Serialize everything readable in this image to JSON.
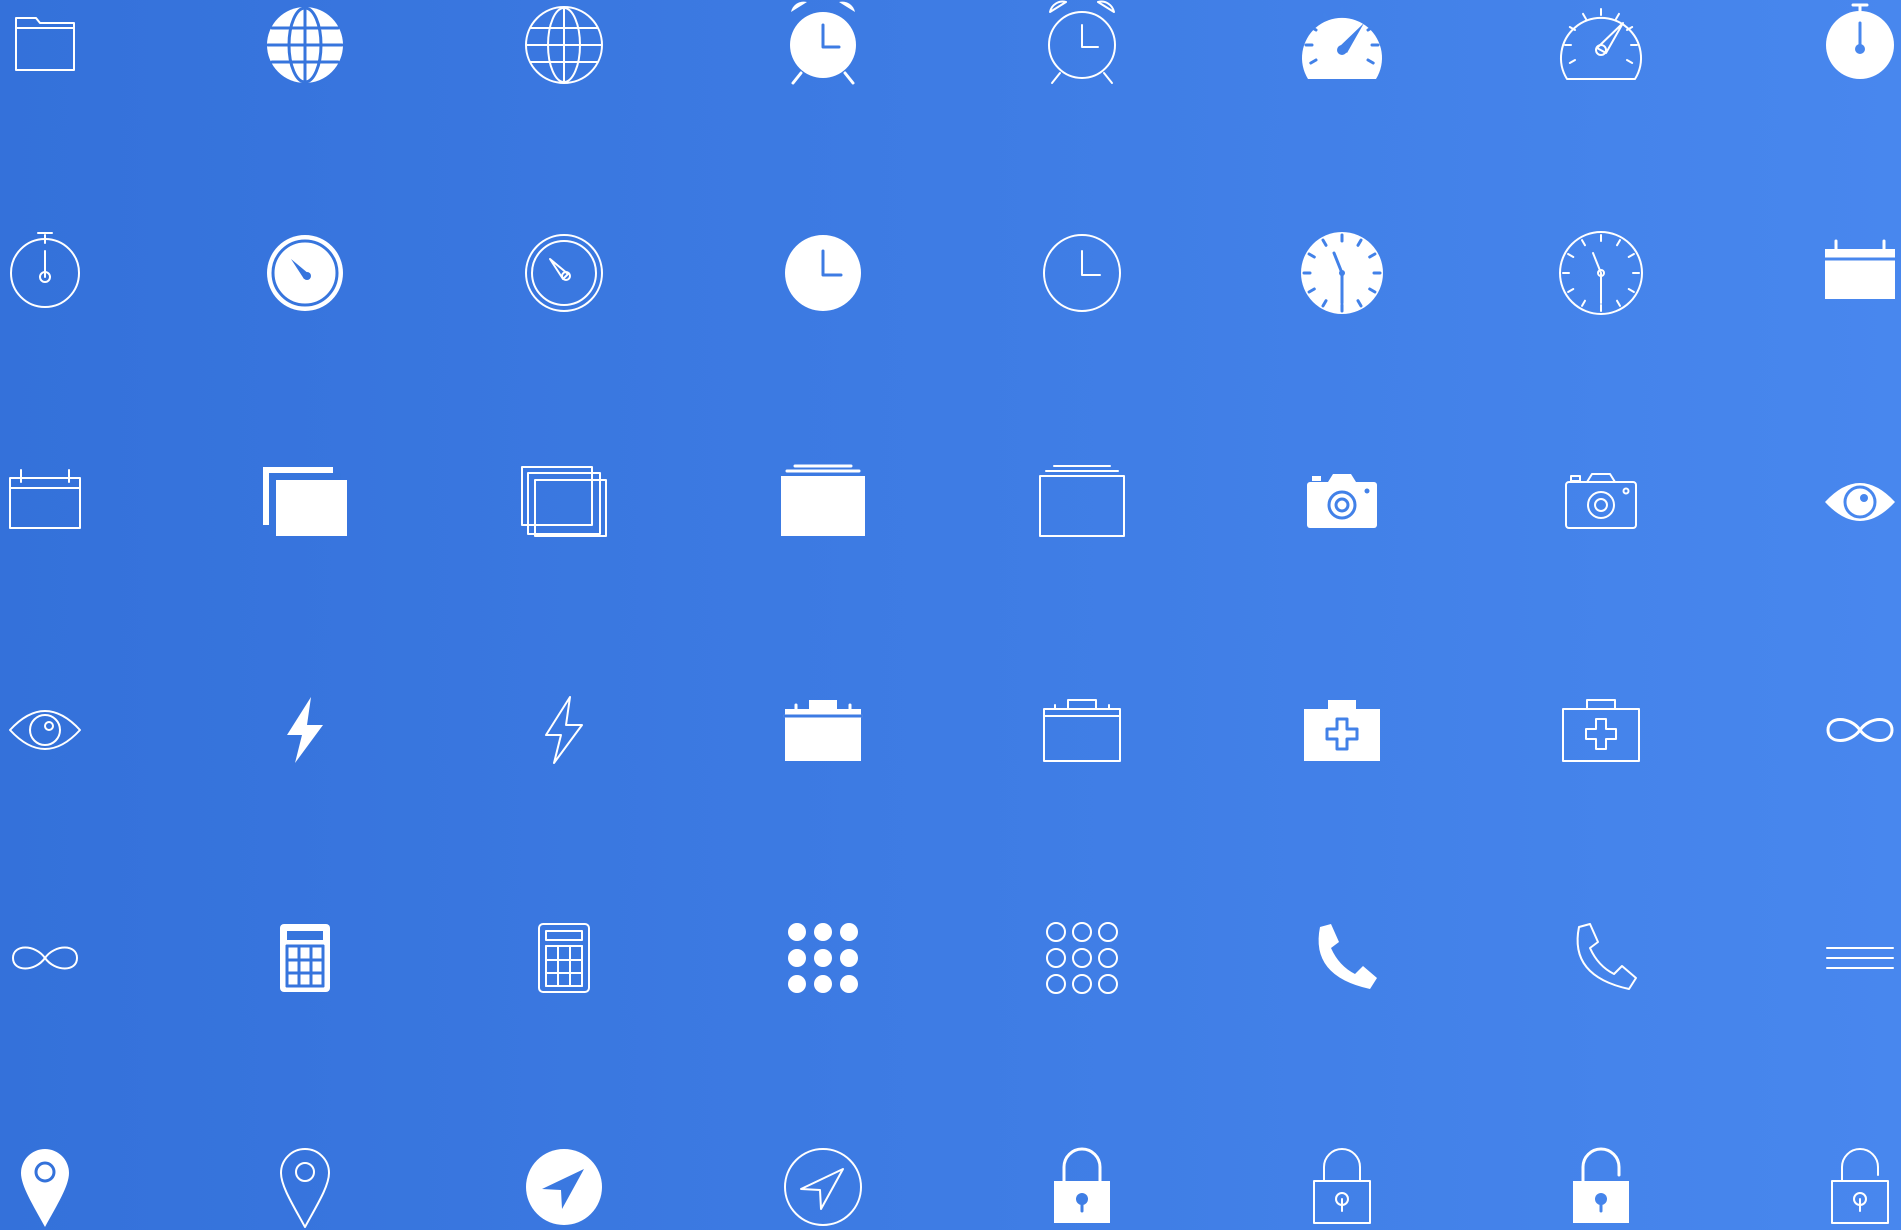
{
  "background": {
    "gradient_start": "#3471da",
    "gradient_end": "#4887ee"
  },
  "icon_color": "#ffffff",
  "icon_rows": [
    [
      {
        "icon": "folder-icon",
        "style": "outline"
      },
      {
        "icon": "globe-icon",
        "style": "filled"
      },
      {
        "icon": "globe-icon",
        "style": "outline"
      },
      {
        "icon": "alarm-clock-icon",
        "style": "filled"
      },
      {
        "icon": "alarm-clock-icon",
        "style": "outline"
      },
      {
        "icon": "speedometer-icon",
        "style": "filled"
      },
      {
        "icon": "speedometer-icon",
        "style": "outline"
      },
      {
        "icon": "stopwatch-icon",
        "style": "filled"
      }
    ],
    [
      {
        "icon": "stopwatch-icon",
        "style": "outline"
      },
      {
        "icon": "timer-icon",
        "style": "filled"
      },
      {
        "icon": "timer-icon",
        "style": "outline"
      },
      {
        "icon": "clock-icon",
        "style": "filled"
      },
      {
        "icon": "clock-icon",
        "style": "outline"
      },
      {
        "icon": "watch-face-icon",
        "style": "filled"
      },
      {
        "icon": "watch-face-icon",
        "style": "outline"
      },
      {
        "icon": "calendar-icon",
        "style": "filled"
      }
    ],
    [
      {
        "icon": "calendar-icon",
        "style": "outline"
      },
      {
        "icon": "copy-windows-icon",
        "style": "filled"
      },
      {
        "icon": "copy-windows-icon",
        "style": "outline"
      },
      {
        "icon": "stacked-folder-icon",
        "style": "filled"
      },
      {
        "icon": "stacked-folder-icon",
        "style": "outline"
      },
      {
        "icon": "camera-icon",
        "style": "filled"
      },
      {
        "icon": "camera-icon",
        "style": "outline"
      },
      {
        "icon": "eye-icon",
        "style": "filled"
      }
    ],
    [
      {
        "icon": "eye-icon",
        "style": "outline"
      },
      {
        "icon": "lightning-bolt-icon",
        "style": "filled"
      },
      {
        "icon": "lightning-bolt-icon",
        "style": "outline"
      },
      {
        "icon": "briefcase-icon",
        "style": "filled"
      },
      {
        "icon": "briefcase-icon",
        "style": "outline"
      },
      {
        "icon": "first-aid-kit-icon",
        "style": "filled"
      },
      {
        "icon": "first-aid-kit-icon",
        "style": "outline"
      },
      {
        "icon": "infinity-icon",
        "style": "filled"
      }
    ],
    [
      {
        "icon": "infinity-icon",
        "style": "outline"
      },
      {
        "icon": "calculator-icon",
        "style": "filled"
      },
      {
        "icon": "calculator-icon",
        "style": "outline"
      },
      {
        "icon": "keypad-icon",
        "style": "filled"
      },
      {
        "icon": "keypad-icon",
        "style": "outline"
      },
      {
        "icon": "phone-icon",
        "style": "filled"
      },
      {
        "icon": "phone-icon",
        "style": "outline"
      },
      {
        "icon": "menu-lines-icon",
        "style": "outline"
      }
    ],
    [
      {
        "icon": "location-pin-icon",
        "style": "filled"
      },
      {
        "icon": "location-pin-icon",
        "style": "outline"
      },
      {
        "icon": "navigation-arrow-icon",
        "style": "filled"
      },
      {
        "icon": "navigation-arrow-icon",
        "style": "outline"
      },
      {
        "icon": "lock-icon",
        "style": "filled"
      },
      {
        "icon": "lock-icon",
        "style": "outline"
      },
      {
        "icon": "unlock-icon",
        "style": "filled"
      },
      {
        "icon": "unlock-icon",
        "style": "outline"
      }
    ]
  ]
}
